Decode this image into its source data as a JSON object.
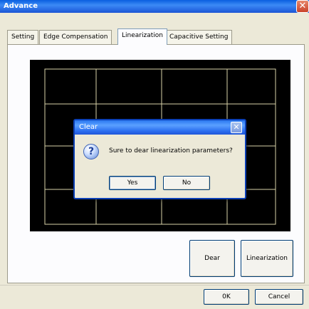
{
  "window": {
    "title": "Advance",
    "close_glyph": "✕"
  },
  "tabs": [
    {
      "label": "Setting",
      "active": false
    },
    {
      "label": "Edge Compensation",
      "active": false
    },
    {
      "label": "Linearization",
      "active": true
    },
    {
      "label": "Capacitive Setting",
      "active": false
    }
  ],
  "grid": {
    "background": "#000000",
    "line_color": "#d8d2a8",
    "columns": 4,
    "rows": 4
  },
  "dialog": {
    "title": "Clear",
    "close_glyph": "✕",
    "icon": "question-icon",
    "icon_glyph": "?",
    "message": "Sure to dear linearization parameters?",
    "yes_label": "Yes",
    "no_label": "No"
  },
  "panel_buttons": {
    "clear_label": "Dear",
    "linearization_label": "Linearization"
  },
  "footer": {
    "ok_label": "0K",
    "cancel_label": "Cancel"
  },
  "colors": {
    "title_bar": "#2a6fe6",
    "window_bg": "#ece9d8",
    "dialog_border": "#0b3fb6"
  }
}
